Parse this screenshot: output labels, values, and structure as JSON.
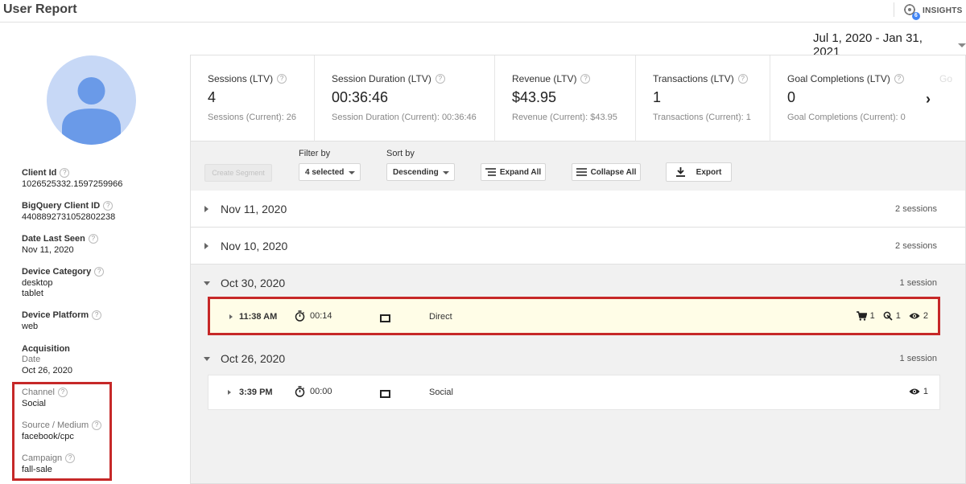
{
  "header": {
    "title": "User Report",
    "insights_label": "INSIGHTS",
    "insights_badge": "6"
  },
  "date_range": "Jul 1, 2020 - Jan 31, 2021",
  "profile": {
    "fields": [
      {
        "label": "Client Id",
        "value": "1026525332.1597259966"
      },
      {
        "label": "BigQuery Client ID",
        "value": "4408892731052802238"
      },
      {
        "label": "Date Last Seen",
        "value": "Nov 11, 2020"
      },
      {
        "label": "Device Category",
        "value": "desktop",
        "value2": "tablet"
      },
      {
        "label": "Device Platform",
        "value": "web"
      }
    ],
    "acquisition": {
      "label": "Acquisition",
      "date_label": "Date",
      "date_value": "Oct 26, 2020",
      "channel_label": "Channel",
      "channel_value": "Social",
      "source_label": "Source / Medium",
      "source_value": "facebook/cpc",
      "campaign_label": "Campaign",
      "campaign_value": "fall-sale"
    }
  },
  "metrics": [
    {
      "label": "Sessions (LTV)",
      "value": "4",
      "sub": "Sessions (Current): 26"
    },
    {
      "label": "Session Duration (LTV)",
      "value": "00:36:46",
      "sub": "Session Duration (Current): 00:36:46"
    },
    {
      "label": "Revenue (LTV)",
      "value": "$43.95",
      "sub": "Revenue (Current): $43.95"
    },
    {
      "label": "Transactions (LTV)",
      "value": "1",
      "sub": "Transactions (Current): 1"
    },
    {
      "label": "Goal Completions (LTV)",
      "value": "0",
      "sub": "Goal Completions (Current): 0"
    }
  ],
  "metrics_ghost": "Go",
  "toolbar": {
    "create_segment": "Create Segment",
    "filter_label": "Filter by",
    "filter_value": "4 selected",
    "sort_label": "Sort by",
    "sort_value": "Descending",
    "expand_all": "Expand All",
    "collapse_all": "Collapse All",
    "export": "Export"
  },
  "days": [
    {
      "date": "Nov 11, 2020",
      "count": "2 sessions"
    },
    {
      "date": "Nov 10, 2020",
      "count": "2 sessions"
    },
    {
      "date": "Oct 30, 2020",
      "count": "1 session"
    },
    {
      "date": "Oct 26, 2020",
      "count": "1 session"
    }
  ],
  "sessions": [
    {
      "time": "11:38 AM",
      "duration": "00:14",
      "channel": "Direct",
      "cart": "1",
      "goal": "1",
      "views": "2"
    },
    {
      "time": "3:39 PM",
      "duration": "00:00",
      "channel": "Social",
      "views": "1"
    }
  ],
  "colors": {
    "highlight_border": "#c62828",
    "highlight_bg": "#fffde7",
    "avatar_bg": "#c7d8f6",
    "avatar_fg": "#6a9ae8"
  }
}
